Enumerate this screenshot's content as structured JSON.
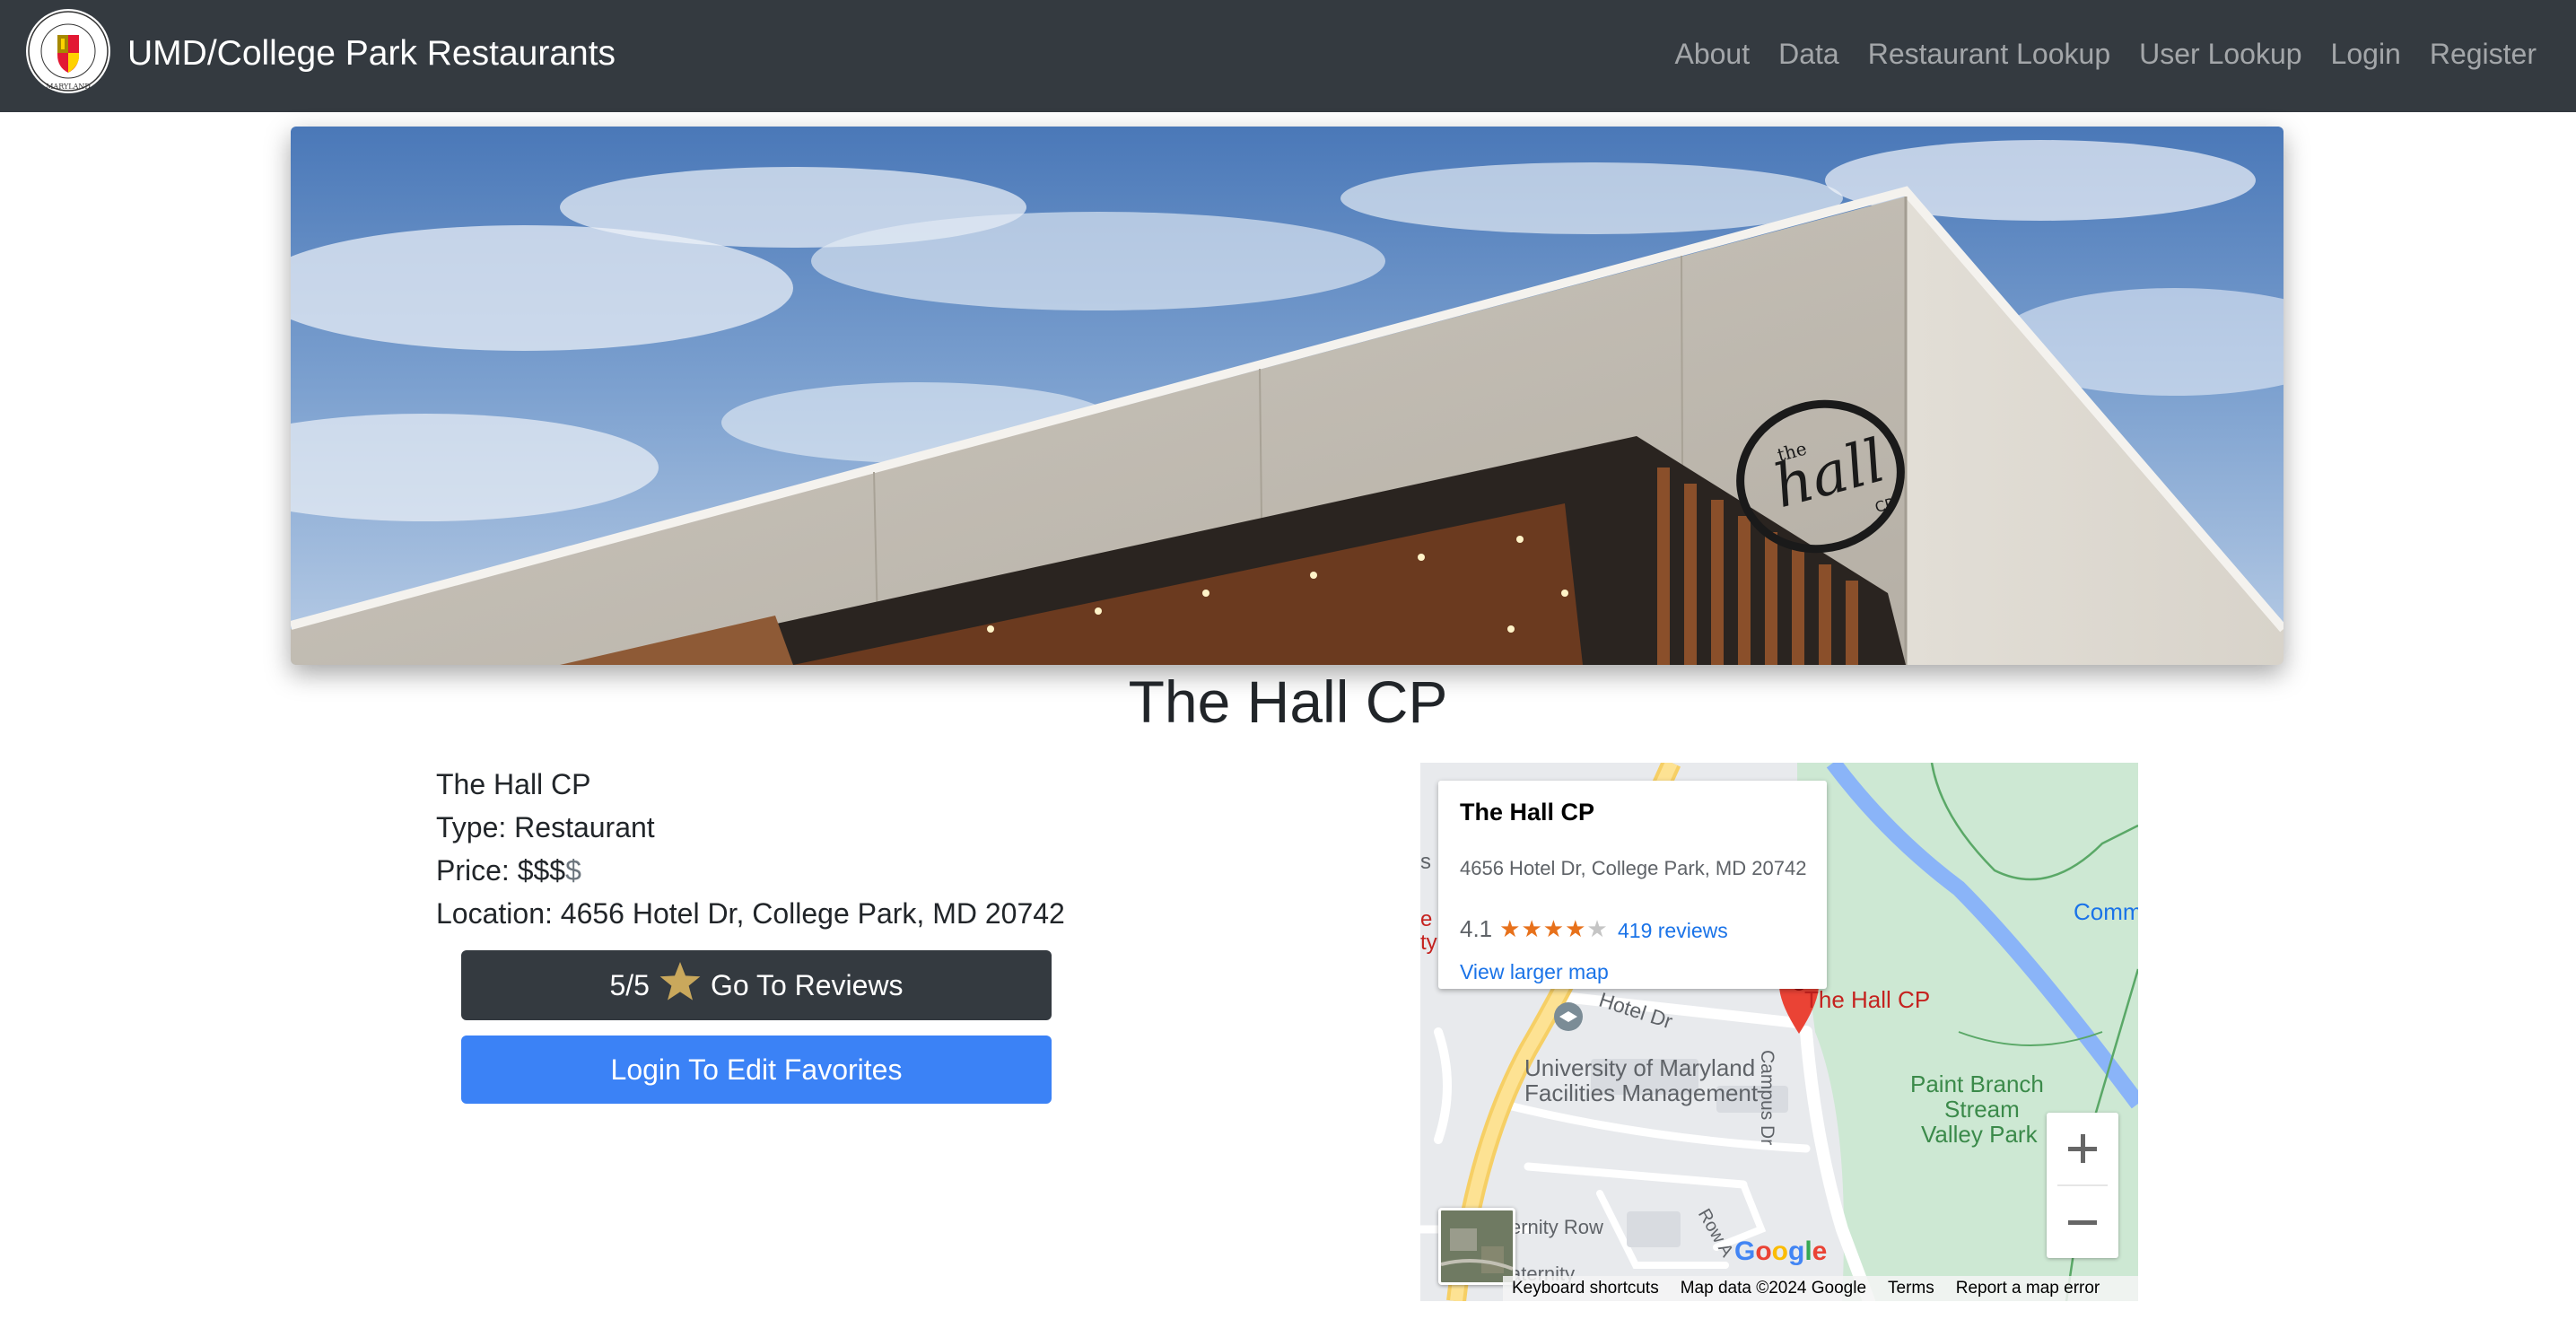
{
  "navbar": {
    "brand": "UMD/College Park Restaurants",
    "links": [
      "About",
      "Data",
      "Restaurant Lookup",
      "User Lookup",
      "Login",
      "Register"
    ]
  },
  "restaurant": {
    "title": "The Hall CP",
    "name": "The Hall CP",
    "type_line": "Type: Restaurant",
    "price_label": "Price: ",
    "price_active": "$$$",
    "price_inactive": "$",
    "location_line": "Location: 4656 Hotel Dr, College Park, MD 20742"
  },
  "buttons": {
    "reviews_score": "5/5",
    "reviews_label": "Go To Reviews",
    "favorites_label": "Login To Edit Favorites"
  },
  "map": {
    "card_name": "The Hall CP",
    "card_address": "4656 Hotel Dr, College Park, MD 20742",
    "card_rating": "4.1",
    "card_reviews": "419 reviews",
    "card_larger_map": "View larger map",
    "rating_value": 4.1,
    "marker_label": "The Hall CP",
    "labels": {
      "hotel_dr": "Hotel Dr",
      "umd_facilities_1": "University of Maryland",
      "umd_facilities_2": "Facilities Management",
      "campus_dr": "Campus Dr",
      "paint_branch_1": "Paint Branch",
      "paint_branch_2": "Stream",
      "paint_branch_3": "Valley Park",
      "fraternity_row": "ernity Row",
      "fraternity_2": "aternity",
      "comm": "Comm",
      "rossborough": "Row A"
    },
    "google": "Google",
    "footer": [
      "Keyboard shortcuts",
      "Map data ©2024 Google",
      "Terms",
      "Report a map error"
    ]
  }
}
